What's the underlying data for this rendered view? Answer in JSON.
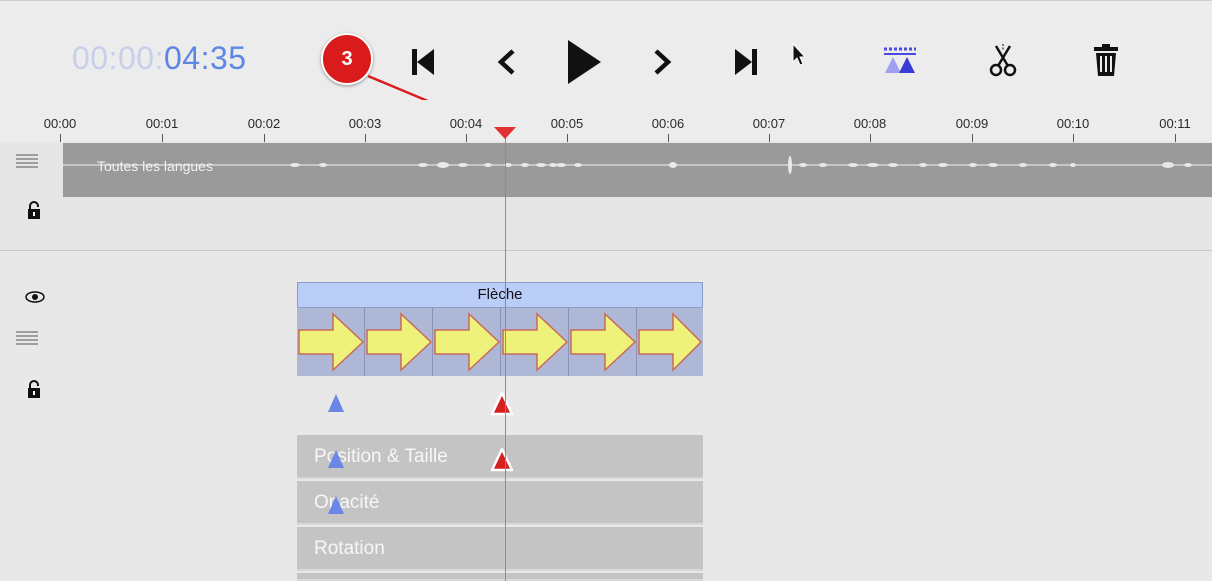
{
  "toolbar": {
    "timecode_dim": "00:00:",
    "timecode_bright": "04:35",
    "annotation_number": "3"
  },
  "ruler": {
    "labels": [
      "00:00",
      "00:01",
      "00:02",
      "00:03",
      "00:04",
      "00:05",
      "00:06",
      "00:07",
      "00:08",
      "00:09",
      "00:10",
      "00:11"
    ]
  },
  "audio": {
    "label": "Toutes les langues"
  },
  "clip": {
    "title": "Flèche",
    "frame_count": 6
  },
  "params": [
    "Position & Taille",
    "Opacité",
    "Rotation"
  ],
  "colors": {
    "timecode_accent": "#5b87e6",
    "playhead": "#e03030",
    "keyframe_blue": "#6b86e6",
    "keyframe_red": "#d62020",
    "arrow_fill": "#eef27a"
  },
  "icons": [
    "skip-to-start-icon",
    "step-back-icon",
    "play-icon",
    "step-forward-icon",
    "skip-to-end-icon",
    "pointer-icon",
    "keyframe-icon",
    "scissors-icon",
    "trash-icon",
    "lines-icon",
    "lock-icon",
    "eye-icon"
  ]
}
